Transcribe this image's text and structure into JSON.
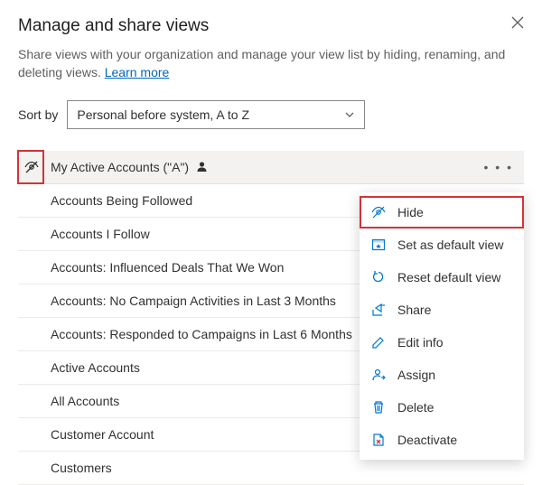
{
  "header": {
    "title": "Manage and share views",
    "description": "Share views with your organization and manage your view list by hiding, renaming, and deleting views. ",
    "learn_more": "Learn more"
  },
  "sort": {
    "label": "Sort by",
    "value": "Personal before system, A to Z"
  },
  "views": [
    {
      "name": "My Active Accounts (\"A\")",
      "personal": true,
      "selected": true
    },
    {
      "name": "Accounts Being Followed"
    },
    {
      "name": "Accounts I Follow"
    },
    {
      "name": "Accounts: Influenced Deals That We Won"
    },
    {
      "name": "Accounts: No Campaign Activities in Last 3 Months"
    },
    {
      "name": "Accounts: Responded to Campaigns in Last 6 Months"
    },
    {
      "name": "Active Accounts"
    },
    {
      "name": "All Accounts"
    },
    {
      "name": "Customer Account"
    },
    {
      "name": "Customers"
    }
  ],
  "menu": {
    "items": [
      {
        "id": "hide",
        "label": "Hide",
        "icon": "hide-icon",
        "highlight": true
      },
      {
        "id": "set-default",
        "label": "Set as default view",
        "icon": "set-default-icon"
      },
      {
        "id": "reset-default",
        "label": "Reset default view",
        "icon": "reset-icon"
      },
      {
        "id": "share",
        "label": "Share",
        "icon": "share-icon"
      },
      {
        "id": "edit-info",
        "label": "Edit info",
        "icon": "edit-icon"
      },
      {
        "id": "assign",
        "label": "Assign",
        "icon": "assign-icon"
      },
      {
        "id": "delete",
        "label": "Delete",
        "icon": "delete-icon"
      },
      {
        "id": "deactivate",
        "label": "Deactivate",
        "icon": "deactivate-icon"
      }
    ]
  }
}
